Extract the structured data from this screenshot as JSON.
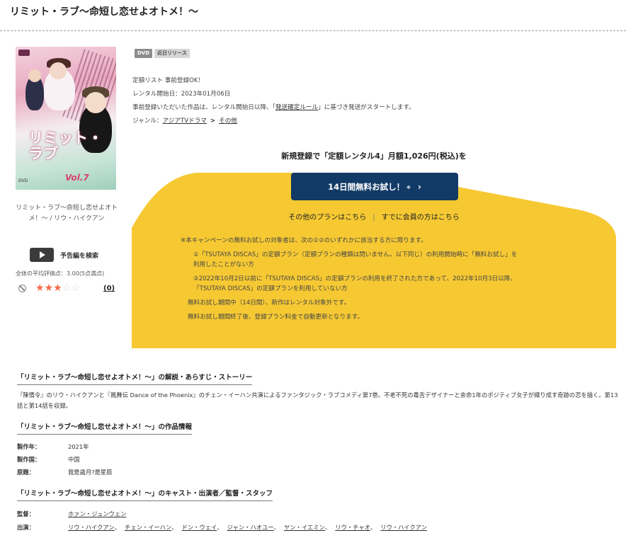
{
  "title": "リミット・ラブ～命短し恋せよオトメ！～",
  "cover": {
    "alt": "リミット・ラブ～命短し恋せよオトメ！～ Vol.7 ジャケット",
    "title_text": "リミット・ラブ",
    "vol": "Vol.7",
    "dvd_mark": "DVD"
  },
  "cover_caption": "リミット・ラブ～命短し恋せよオトメ！～ / リウ・ハイクアン",
  "trailer_label": "予告編を検索",
  "rating": {
    "average_label": "全体の平均評価点：",
    "average_value": "3.00(5点満点)",
    "stars_filled": 3,
    "stars_total": 5,
    "review_count": "(0)"
  },
  "badges": [
    "DVD",
    "近日リリース"
  ],
  "details": {
    "line1": "定額リスト 事前登録OK！",
    "line2": "レンタル開始日：2023年01月06日",
    "line3_pre": "事前登録いただいた作品は、レンタル開始日以降、「",
    "line3_link": "発送確定ルール",
    "line3_post": "」に基づき発送がスタートします。",
    "genre_label": "ジャンル：",
    "genre_1": "アジアTVドラマ",
    "genre_sep": ">",
    "genre_2": "その他"
  },
  "promo": {
    "headline": "新規登録で「定額レンタル4」月額1,026円(税込)を",
    "cta_label": "14日間無料お試し！",
    "cta_note": "※",
    "cta_chevron": "›",
    "other_plans": "その他のプランはこちら",
    "divider": "|",
    "members": "すでに会員の方はこちら",
    "colors": {
      "yellow": "#f6c933",
      "navy": "#123a66"
    }
  },
  "campaign": {
    "intro": "※本キャンペーンの無料お試しの対象者は、次の①②のいずれかに該当する方に限ります。",
    "item1_a": "①「TSUTAYA DISCAS」の定額プラン（定額プランの種類は問いません。以下同じ）の利用開始時に「無料お試し」を",
    "item1_b": "利用したことがない方",
    "item2_a": "②2022年10月2日以前に「TSUTAYA DISCAS」の定額プランの利用を終了された方であって、2022年10月3日以降、",
    "item2_b": "「TSUTAYA DISCAS」の定額プランを利用していない方",
    "note1": "無料お試し期間中（14日間）、新作はレンタル対象外です。",
    "note2": "無料お試し期間終了後、登録プラン料金で自動更新となります。"
  },
  "sections": {
    "synopsis_heading": "「リミット・ラブ～命短し恋せよオトメ！～」の解説・あらすじ・ストーリー",
    "synopsis_text": "『陳情令』のリウ・ハイクアンと『鳳舞伝 Dance of the Phoenix』のチェン・イーハン共演によるファンタジック・ラブコメディ第7巻。不老不死の毒舌デザイナーと余命1年のポジティブ女子が織り成す奇跡の恋を描く。第13話と第14話を収録。",
    "info_heading": "「リミット・ラブ～命短し恋せよオトメ！～」の作品情報",
    "info": [
      {
        "label": "製作年：",
        "value": "2021年"
      },
      {
        "label": "製作国：",
        "value": "中国"
      },
      {
        "label": "原題：",
        "value": "我是歲月?是星辰"
      }
    ],
    "cast_heading": "「リミット・ラブ～命短し恋せよオトメ！～」のキャスト・出演者／監督・スタッフ",
    "director_label": "監督：",
    "director": "ホァン・ジュンウェン",
    "cast_label": "出演：",
    "cast": [
      "リウ・ハイクアン",
      "チェン・イーハン",
      "ドン・ウェイ",
      "ジャン・ハオユー",
      "ヤン・イエミン",
      "リウ・チャオ",
      "リウ・ハイクアン"
    ],
    "cast_sep": "、"
  }
}
